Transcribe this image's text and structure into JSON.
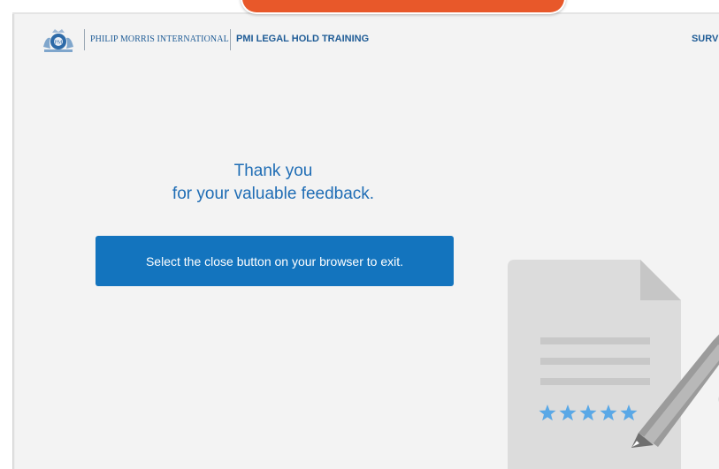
{
  "header": {
    "brand": "PHILIP MORRIS INTERNATIONAL",
    "course_title": "PMI LEGAL HOLD TRAINING",
    "survey_label": "SURVEY"
  },
  "main": {
    "thanks_line1": "Thank you",
    "thanks_line2": "for your valuable feedback.",
    "exit_message": "Select the close button on your browser to exit."
  },
  "illustration": {
    "rating_stars": 5
  },
  "colors": {
    "accent": "#1374be",
    "heading_text": "#1f6db5",
    "header_text": "#1f5c96",
    "orange_tab": "#e8582a",
    "background": "#f3f3f3",
    "star": "#5aa8e6"
  }
}
